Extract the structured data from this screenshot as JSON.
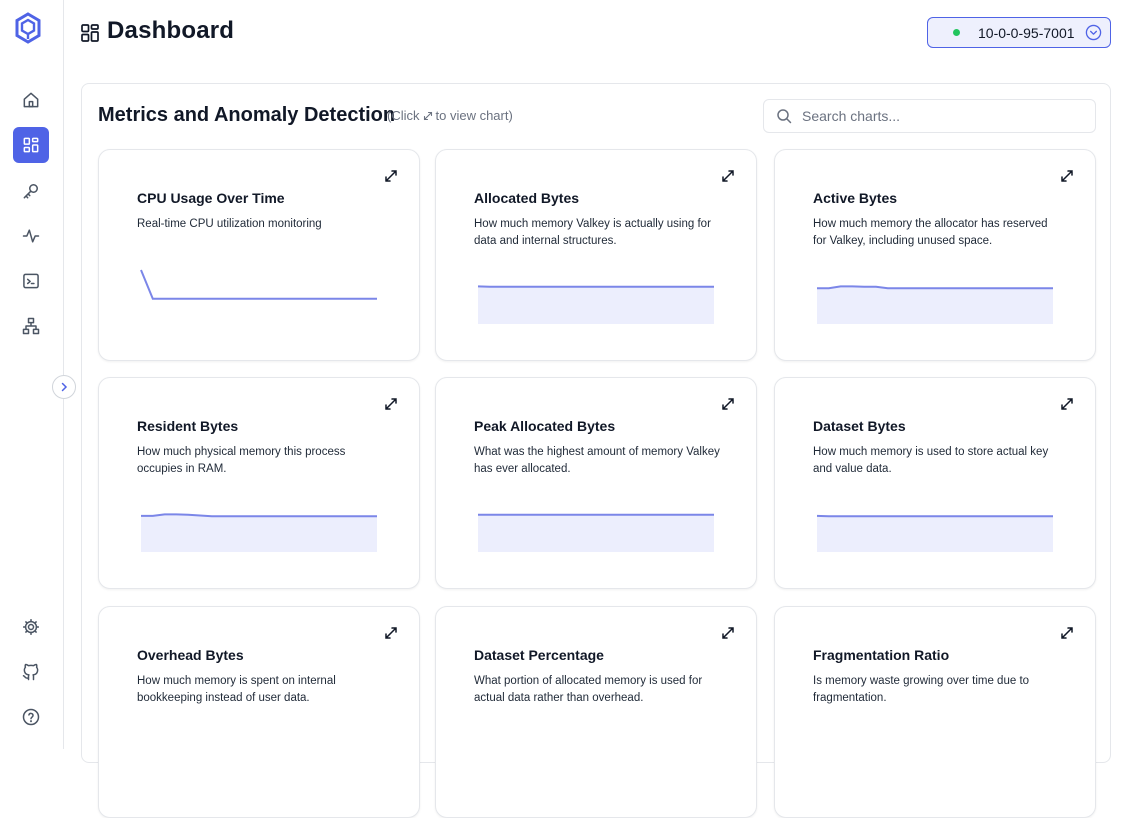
{
  "sidebar": {
    "logo": "valkey-hexagon-logo",
    "items": [
      {
        "name": "home",
        "icon": "house-icon",
        "active": false
      },
      {
        "name": "dashboard",
        "icon": "grid-icon",
        "active": true
      },
      {
        "name": "key-browser",
        "icon": "key-icon",
        "active": false
      },
      {
        "name": "monitoring",
        "icon": "activity-icon",
        "active": false
      },
      {
        "name": "terminal",
        "icon": "terminal-icon",
        "active": false
      },
      {
        "name": "cluster",
        "icon": "network-icon",
        "active": false
      }
    ],
    "bottom_items": [
      {
        "name": "settings",
        "icon": "gear-icon"
      },
      {
        "name": "github",
        "icon": "github-icon"
      },
      {
        "name": "help",
        "icon": "help-circle-icon"
      }
    ]
  },
  "header": {
    "title": "Dashboard",
    "connection": {
      "label": "10-0-0-95-7001",
      "status_color": "#22c55e"
    }
  },
  "metrics": {
    "title": "Metrics and Anomaly Detection",
    "hint_before": "(Click",
    "hint_after": "to view chart)",
    "search_placeholder": "Search charts..."
  },
  "colors": {
    "accent": "#4f63e6",
    "chart_line": "#7b86e8",
    "chart_fill": "#eceefd"
  },
  "cards": [
    {
      "title": "CPU Usage Over Time",
      "description": "Real-time CPU utilization monitoring",
      "series": [
        100,
        10,
        10,
        10,
        10,
        10,
        10,
        10,
        10,
        10,
        10,
        10,
        10,
        10,
        10,
        10,
        10,
        10,
        10,
        10,
        10
      ],
      "filled": false
    },
    {
      "title": "Allocated Bytes",
      "description": "How much memory Valkey is actually using for data and internal structures.",
      "series": [
        98,
        97,
        97,
        97,
        97,
        97,
        97,
        97,
        97,
        97,
        97,
        97,
        97,
        97,
        97,
        97,
        97,
        97,
        97,
        97,
        97
      ],
      "filled": true
    },
    {
      "title": "Active Bytes",
      "description": "How much memory the allocator has reserved for Valkey, including unused space.",
      "series": [
        93,
        93,
        98,
        98,
        97,
        97,
        93,
        93,
        93,
        93,
        93,
        93,
        93,
        93,
        93,
        93,
        93,
        93,
        93,
        93,
        93
      ],
      "filled": true
    },
    {
      "title": "Resident Bytes",
      "description": "How much physical memory this process occupies in RAM.",
      "series": [
        94,
        94,
        98,
        98,
        97,
        95,
        93,
        93,
        93,
        93,
        93,
        93,
        93,
        93,
        93,
        93,
        93,
        93,
        93,
        93,
        93
      ],
      "filled": true
    },
    {
      "title": "Peak Allocated Bytes",
      "description": "What was the highest amount of memory Valkey has ever allocated.",
      "series": [
        97,
        97,
        97,
        97,
        97,
        97,
        97,
        97,
        97,
        97,
        97,
        97,
        97,
        97,
        97,
        97,
        97,
        97,
        97,
        97,
        97
      ],
      "filled": true
    },
    {
      "title": "Dataset Bytes",
      "description": "How much memory is used to store actual key and value data.",
      "series": [
        94,
        93,
        93,
        93,
        93,
        93,
        93,
        93,
        93,
        93,
        93,
        93,
        93,
        93,
        93,
        93,
        93,
        93,
        93,
        93,
        93
      ],
      "filled": true
    },
    {
      "title": "Overhead Bytes",
      "description": "How much memory is spent on internal bookkeeping instead of user data.",
      "series": [],
      "filled": true
    },
    {
      "title": "Dataset Percentage",
      "description": "What portion of allocated memory is used for actual data rather than overhead.",
      "series": [],
      "filled": true
    },
    {
      "title": "Fragmentation Ratio",
      "description": "Is memory waste growing over time due to fragmentation.",
      "series": [],
      "filled": true
    }
  ]
}
